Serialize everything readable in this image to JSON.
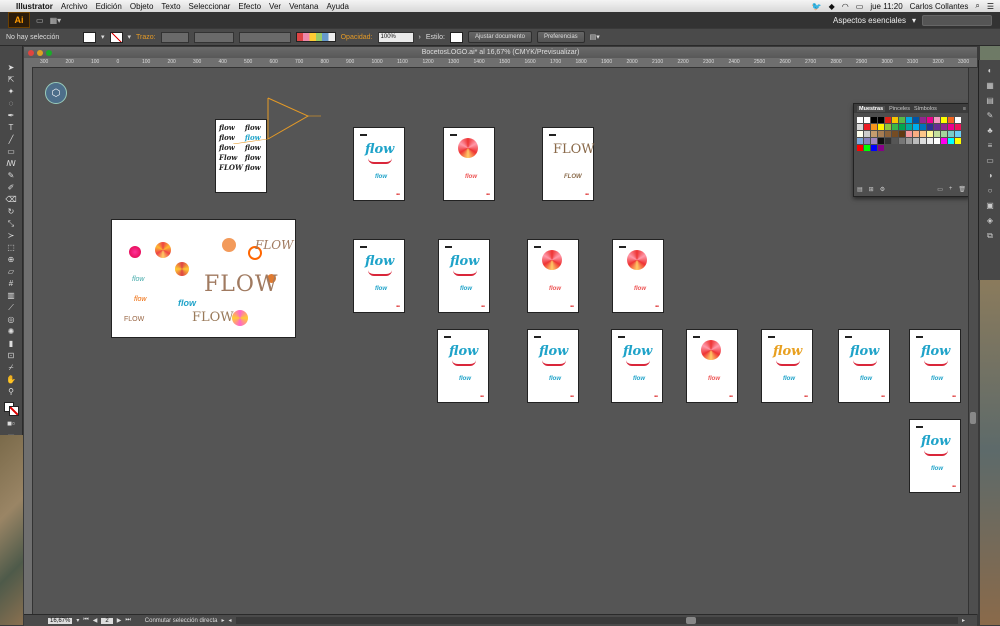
{
  "menubar": {
    "app": "Illustrator",
    "items": [
      "Archivo",
      "Edición",
      "Objeto",
      "Texto",
      "Seleccionar",
      "Efecto",
      "Ver",
      "Ventana",
      "Ayuda"
    ],
    "time": "jue 11:20",
    "user": "Carlos Collantes"
  },
  "appbar": {
    "logo": "Ai",
    "workspace": "Aspectos esenciales"
  },
  "control": {
    "selection": "No hay selección",
    "stroke_label": "Trazo:",
    "opacity_label": "Opacidad:",
    "opacity_value": "100%",
    "style_label": "Estilo:",
    "doc_setup": "Ajustar documento",
    "prefs": "Preferencias"
  },
  "document": {
    "title": "BocetosLOGO.ai* al 16,67% (CMYK/Previsualizar)"
  },
  "ruler_ticks": [
    "300",
    "200",
    "100",
    "0",
    "100",
    "200",
    "300",
    "400",
    "500",
    "600",
    "700",
    "800",
    "900",
    "1000",
    "1100",
    "1200",
    "1300",
    "1400",
    "1500",
    "1600",
    "1700",
    "1800",
    "1900",
    "2000",
    "2100",
    "2200",
    "2300",
    "2400",
    "2500",
    "2600",
    "2700",
    "2800",
    "2900",
    "3000",
    "3100",
    "3200",
    "3300"
  ],
  "artboards": {
    "logo_text": "flow",
    "logo_caps": "FLOW",
    "sketch_words": [
      "flow",
      "flow",
      "flow",
      "flow",
      "flow",
      "flow",
      "Flow",
      "flow",
      "FLOW",
      "flow"
    ]
  },
  "swatches_panel": {
    "tabs": [
      "Muestras",
      "Pinceles",
      "Símbolos"
    ]
  },
  "status": {
    "zoom": "16,67%",
    "page": "2",
    "tool_status": "Conmutar selección directa"
  },
  "colors": {
    "accent": "#e59a26",
    "flow_blue": "#1fa3c9",
    "flow_red": "#d9263a"
  }
}
